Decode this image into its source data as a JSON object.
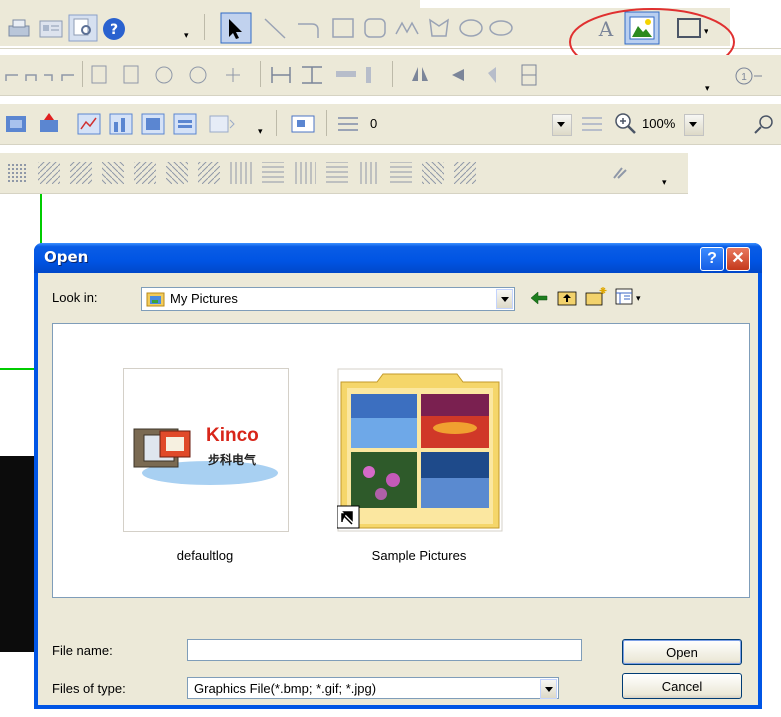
{
  "toolbar": {
    "line_spacing_value": "0",
    "zoom_value": "100%"
  },
  "dialog": {
    "title": "Open",
    "help_glyph": "?",
    "close_glyph": "✕",
    "look_in_label": "Look in:",
    "look_in_value": "My Pictures",
    "items": [
      {
        "name": "defaultlog",
        "logo_text": "Kinco",
        "logo_subtext": "步科电气"
      },
      {
        "name": "Sample Pictures"
      }
    ],
    "file_name_label": "File name:",
    "file_name_value": "",
    "files_of_type_label": "Files of type:",
    "files_of_type_value": "Graphics File(*.bmp; *.gif; *.jpg)",
    "open_label": "Open",
    "cancel_label": "Cancel"
  },
  "icons": [
    "print-icon",
    "properties-icon",
    "preview-icon",
    "help-icon",
    "pointer-icon",
    "line-icon",
    "arc-icon",
    "rectangle-icon",
    "rounded-rectangle-icon",
    "polyline-icon",
    "polygon-icon",
    "ellipse-icon",
    "text-icon",
    "image-icon",
    "frame-icon",
    "back-icon",
    "up-folder-icon",
    "new-folder-icon",
    "view-menu-icon",
    "zoom-icon",
    "find-icon"
  ],
  "accent_colors": {
    "titlebar": "#0054e3",
    "annotation_circle": "#e03030",
    "grid_line": "#00cc00"
  }
}
